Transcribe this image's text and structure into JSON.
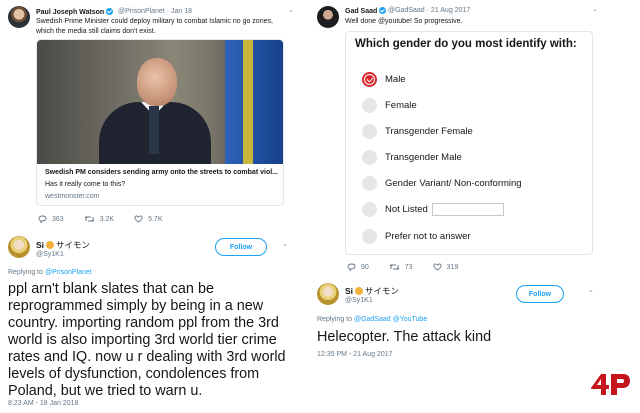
{
  "tweet_pjw": {
    "name": "Paul Joseph Watson",
    "handle": "@PrisonPlanet · Jan 18",
    "text_line1": "Swedish Prime Minister could deploy military to combat Islamic no go zones,",
    "text_line2": "which the media still claims don't exist.",
    "card_title": "Swedish PM considers sending army onto the streets to combat viol...",
    "card_desc": "Has it really come to this?",
    "card_domain": "westmonster.com",
    "replies": "363",
    "retweets": "3.2K",
    "likes": "5.7K"
  },
  "tweet_si1": {
    "name": "Si",
    "name_suffix": "サイモン",
    "handle": "@Sy1K1",
    "follow_label": "Follow",
    "replying_prefix": "Replying to ",
    "replying_to": "@PrisonPlanet",
    "lines": [
      "ppl arn't blank slates that can be",
      "reprogrammed simply by being in a new",
      "country.  importing random ppl from the 3rd",
      "world is also importing 3rd world tier crime",
      "rates and IQ. now u r dealing with 3rd world",
      "levels of dysfunction, condolences from",
      "Poland, but we tried to warn u."
    ],
    "timestamp": "8:23 AM - 18 Jan 2018"
  },
  "tweet_gad": {
    "name": "Gad Saad",
    "handle": "@GadSaad · 21 Aug 2017",
    "text": "Well done @youtube!  So progressive.",
    "poll_title": "Which gender do you most identify with:",
    "options": [
      "Male",
      "Female",
      "Transgender Female",
      "Transgender Male",
      "Gender Variant/ Non-conforming",
      "Not Listed",
      "Prefer not to answer"
    ],
    "selected_option": "Male",
    "replies": "90",
    "retweets": "73",
    "likes": "319"
  },
  "tweet_si2": {
    "name": "Si",
    "name_suffix": "サイモン",
    "handle": "@Sy1K1",
    "follow_label": "Follow",
    "replying_prefix": "Replying to ",
    "replying_to": "@GadSaad @YouTube",
    "text": "Helecopter. The attack kind",
    "timestamp": "12:35 PM - 21 Aug 2017"
  },
  "colors": {
    "twitter_blue": "#1da1f2",
    "muted_gray": "#657786",
    "selected_red": "#d9262c",
    "logo_red": "#c4161c"
  },
  "icons": [
    "reply-icon",
    "retweet-icon",
    "like-icon",
    "chevron-down-icon",
    "verified-badge-icon"
  ],
  "logo_text": "4P"
}
